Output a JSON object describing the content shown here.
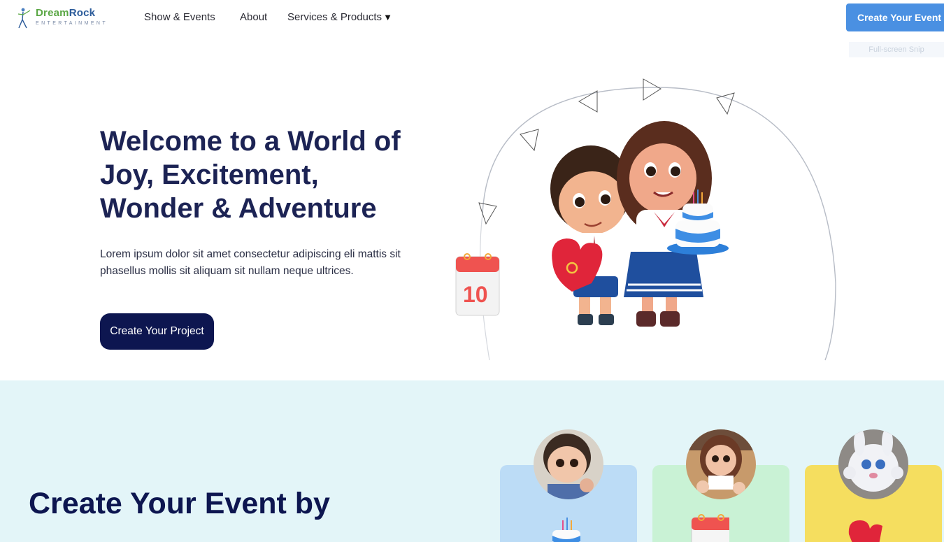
{
  "nav": {
    "logo_primary_a": "Dream",
    "logo_primary_b": "Rock",
    "logo_sub": "ENTERTAINMENT",
    "links": [
      "Show & Events",
      "About",
      "Services & Products"
    ],
    "caret": "▼",
    "cta": "Create Your Event"
  },
  "overlay": {
    "snip_label": "Full-screen Snip"
  },
  "hero": {
    "title": "Welcome to a World of Joy, Excitement, Wonder & Adventure",
    "description": "Lorem ipsum dolor sit amet consectetur adipiscing eli mattis sit phasellus mollis sit aliquam sit nullam neque ultrices.",
    "button": "Create Your Project",
    "calendar_number": "10"
  },
  "section2": {
    "title": "Create Your Event by",
    "cards": [
      {
        "color": "#bcdcf6",
        "icon": "birthday-cake-icon"
      },
      {
        "color": "#c9f2d5",
        "icon": "calendar-icon"
      },
      {
        "color": "#f5de5f",
        "icon": "gift-box-icon"
      }
    ]
  },
  "colors": {
    "brand_navy": "#0d1650",
    "title_navy": "#1c2354",
    "accent_blue": "#4a90e2",
    "section_bg": "#e3f5f8"
  }
}
